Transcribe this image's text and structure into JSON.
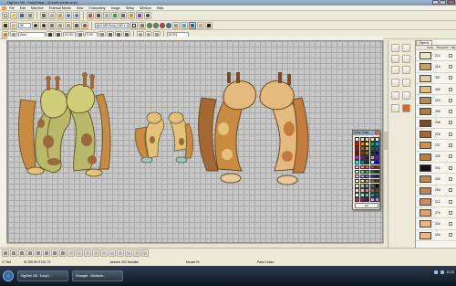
{
  "window": {
    "title": "DigiGen M8 - EasyDesign - [Kısmet zürafa.xmp]",
    "min": "_",
    "max": "□",
    "close": "x"
  },
  "menu": [
    "File",
    "Edit",
    "Machine",
    "External Media",
    "View",
    "Embroidery",
    "Image",
    "Setup",
    "Window",
    "Help"
  ],
  "toolbar2": {
    "zoom": "56",
    "size": "Art1 M8 Hoop (180 x 130)"
  },
  "toolbar3": {
    "font": "Arial",
    "height": "10.00",
    "width": "3.00",
    "rotate": "(0.00)"
  },
  "panel": {
    "tabs": [
      "Objects"
    ],
    "headers": [
      "Color",
      "Thread ID",
      "Obj"
    ],
    "rows": [
      {
        "num": "214",
        "color": "#eae7c5"
      },
      {
        "num": "216",
        "color": "#c8a25e"
      },
      {
        "num": "337",
        "color": "#e9c99a"
      },
      {
        "num": "305",
        "color": "#e4ba7e"
      },
      {
        "num": "212",
        "color": "#b98a56"
      },
      {
        "num": "299",
        "color": "#ad7a45"
      },
      {
        "num": "208",
        "color": "#7a4a22"
      },
      {
        "num": "226",
        "color": "#a56833"
      },
      {
        "num": "237",
        "color": "#d1904c"
      },
      {
        "num": "239",
        "color": "#c27c3e"
      },
      {
        "num": "002",
        "color": "#141414"
      },
      {
        "num": "240",
        "color": "#c08351"
      },
      {
        "num": "253",
        "color": "#b98457"
      },
      {
        "num": "211",
        "color": "#d08d5b"
      },
      {
        "num": "276",
        "color": "#e1a26a"
      },
      {
        "num": "204",
        "color": "#f1b37f"
      },
      {
        "num": "204",
        "color": "#efb580"
      }
    ]
  },
  "color_chart": {
    "title": "Color Chart",
    "ok": "OK",
    "colors": [
      "#ffffff",
      "#ffe0e0",
      "#ffd0a0",
      "#fff0a0",
      "#e0ffe0",
      "#ff0000",
      "#ff8000",
      "#ffff00",
      "#00c000",
      "#00a0ff",
      "#c00000",
      "#c06000",
      "#c0c000",
      "#008000",
      "#0060c0",
      "#800000",
      "#804000",
      "#808000",
      "#004000",
      "#000080",
      "#ff00ff",
      "#a000a0",
      "#600060",
      "#ff80c0",
      "#8000ff",
      "#00ffff",
      "#008080",
      "#004040",
      "#80ffff",
      "#0000ff",
      "#ffc0c0",
      "#ffa0a0",
      "#ff6060",
      "#e04040",
      "#a02020",
      "#c0ffc0",
      "#80e080",
      "#40c040",
      "#208020",
      "#104010",
      "#d0d0ff",
      "#a0a0ff",
      "#6060ff",
      "#3030c0",
      "#101060",
      "#ffffd0",
      "#ffe080",
      "#e0b040",
      "#a07020",
      "#603000",
      "#f0f0f0",
      "#c0c0c0",
      "#909090",
      "#606060",
      "#000000",
      "#ffe0c0",
      "#f0c090",
      "#d09060",
      "#a06030",
      "#704020",
      "#e0ffff",
      "#a0e0e0",
      "#60c0c0",
      "#309090",
      "#106060",
      "#ff0080",
      "#c00060",
      "#800040",
      "#ff80ff",
      "#c080ff"
    ]
  },
  "status": {
    "stitches": "17 0x0",
    "size": "W 159.99 H 131 73",
    "hint": "Janome 202 Needles",
    "mouse": "Mouse RI",
    "color": "Pass Colour"
  },
  "taskbar": {
    "items": [
      "DigiGen M8 - EasyD...",
      "Enlarges - Windows..."
    ],
    "clock": "12:22"
  },
  "colors": {
    "canvas": "#c8c8c8",
    "grid": "#a9a9a9",
    "giraffe_light": "#e4c27a",
    "giraffe_dark": "#8a6a3c",
    "giraffe_green": "#b9b96a",
    "spots_brown": "#9a6a3a",
    "mane_orange": "#c98a42"
  }
}
